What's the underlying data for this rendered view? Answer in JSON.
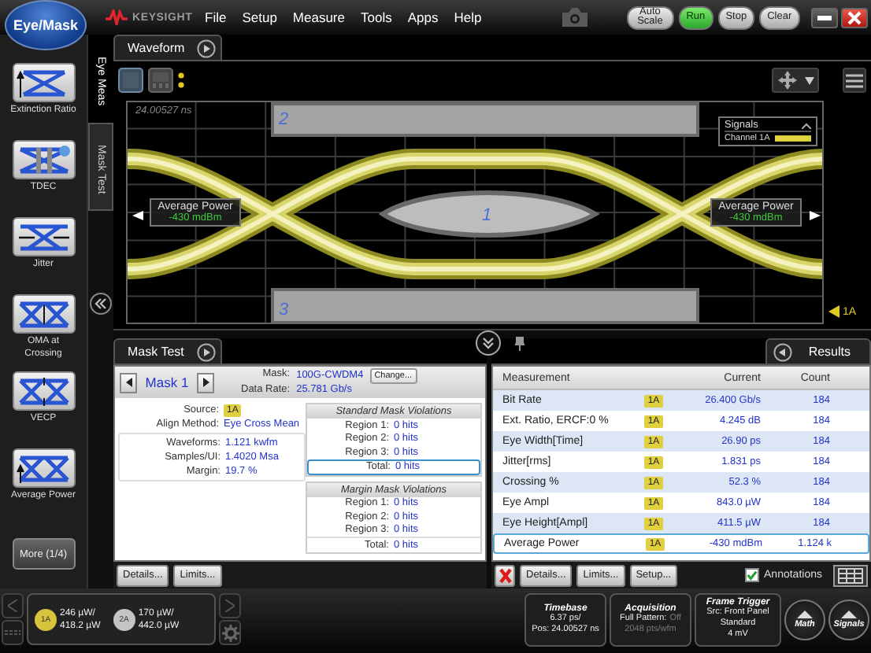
{
  "app_button": "Eye/Mask",
  "brand": "KEYSIGHT",
  "menu": [
    "File",
    "Setup",
    "Measure",
    "Tools",
    "Apps",
    "Help"
  ],
  "toolbar_buttons": [
    {
      "label": "Auto Scale",
      "on": false
    },
    {
      "label": "Run",
      "on": true
    },
    {
      "label": "Stop",
      "on": false
    },
    {
      "label": "Clear",
      "on": false
    }
  ],
  "sidebar": {
    "items": [
      "Extinction Ratio",
      "TDEC",
      "Jitter",
      "OMA at Crossing",
      "VECP",
      "Average Power"
    ],
    "more": "More (1/4)"
  },
  "vertical_tabs": [
    {
      "label": "Eye Meas",
      "selected": true
    },
    {
      "label": "Mask Test",
      "selected": false
    }
  ],
  "waveform": {
    "tab": "Waveform",
    "timestamp": "24.00527 ns",
    "mask_regions": [
      "2",
      "1",
      "3"
    ],
    "annotations": [
      {
        "label": "Average Power",
        "value": "-430 mdBm"
      },
      {
        "label": "Average Power",
        "value": "-430 mdBm"
      }
    ],
    "legend": {
      "title": "Signals",
      "channel": "Channel 1A"
    },
    "channel_marker": "1A"
  },
  "mask_test": {
    "tab": "Mask Test",
    "mask_name": "Mask 1",
    "mask_label": "Mask:",
    "mask_value": "100G-CWDM4",
    "change_button": "Change...",
    "rate_label": "Data Rate:",
    "rate_value": "25.781 Gb/s",
    "source": {
      "label": "Source:",
      "value": "1A"
    },
    "align": {
      "label": "Align Method:",
      "value": "Eye Cross Mean"
    },
    "stats": [
      {
        "label": "Waveforms:",
        "value": "1.121 kwfm"
      },
      {
        "label": "Samples/UI:",
        "value": "1.4020 Msa"
      },
      {
        "label": "Margin:",
        "value": "19.7 %"
      }
    ],
    "violation_groups": [
      {
        "title": "Standard Mask Violations",
        "rows": [
          {
            "label": "Region 1:",
            "value": "0 hits"
          },
          {
            "label": "Region 2:",
            "value": "0 hits"
          },
          {
            "label": "Region 3:",
            "value": "0 hits"
          }
        ],
        "total": {
          "label": "Total:",
          "value": "0 hits",
          "selected": true
        }
      },
      {
        "title": "Margin Mask Violations",
        "rows": [
          {
            "label": "Region 1:",
            "value": "0 hits"
          },
          {
            "label": "Region 2:",
            "value": "0 hits"
          },
          {
            "label": "Region 3:",
            "value": "0 hits"
          }
        ],
        "total": {
          "label": "Total:",
          "value": "0 hits",
          "selected": false
        }
      }
    ],
    "buttons": [
      "Details...",
      "Limits..."
    ]
  },
  "results": {
    "tab": "Results",
    "columns": [
      "Measurement",
      "Current",
      "Count"
    ],
    "rows": [
      {
        "name": "Bit Rate",
        "source": "1A",
        "current": "26.400 Gb/s",
        "count": "184",
        "selected": false
      },
      {
        "name": "Ext. Ratio, ERCF:0 %",
        "source": "1A",
        "current": "4.245 dB",
        "count": "184",
        "selected": false
      },
      {
        "name": "Eye Width[Time]",
        "source": "1A",
        "current": "26.90 ps",
        "count": "184",
        "selected": false
      },
      {
        "name": "Jitter[rms]",
        "source": "1A",
        "current": "1.831 ps",
        "count": "184",
        "selected": false
      },
      {
        "name": "Crossing %",
        "source": "1A",
        "current": "52.3 %",
        "count": "184",
        "selected": false
      },
      {
        "name": "Eye Ampl",
        "source": "1A",
        "current": "843.0 µW",
        "count": "184",
        "selected": false
      },
      {
        "name": "Eye Height[Ampl]",
        "source": "1A",
        "current": "411.5 µW",
        "count": "184",
        "selected": false
      },
      {
        "name": "Average Power",
        "source": "1A",
        "current": "-430 mdBm",
        "count": "1.124 k",
        "selected": true
      }
    ],
    "buttons": [
      "Details...",
      "Limits...",
      "Setup..."
    ],
    "annotations": {
      "label": "Annotations",
      "checked": true
    }
  },
  "status": {
    "channels": [
      {
        "badge": "1A",
        "line1": "246 µW/",
        "line2": "418.2 µW",
        "color": "#d8c43c"
      },
      {
        "badge": "2A",
        "line1": "170 µW/",
        "line2": "442.0 µW",
        "color": "#c4c4c4"
      }
    ],
    "timebase": {
      "title": "Timebase",
      "lines": [
        "6.37 ps/",
        "Pos: 24.00527 ns"
      ]
    },
    "acquisition": {
      "title": "Acquisition",
      "label": "Full Pattern:",
      "state": "Off",
      "detail": "2048 pts/wfm"
    },
    "trigger": {
      "title": "Frame Trigger",
      "lines": [
        "Src: Front Panel",
        "Standard",
        "4 mV"
      ]
    },
    "round_buttons": [
      "Math",
      "Signals"
    ]
  }
}
